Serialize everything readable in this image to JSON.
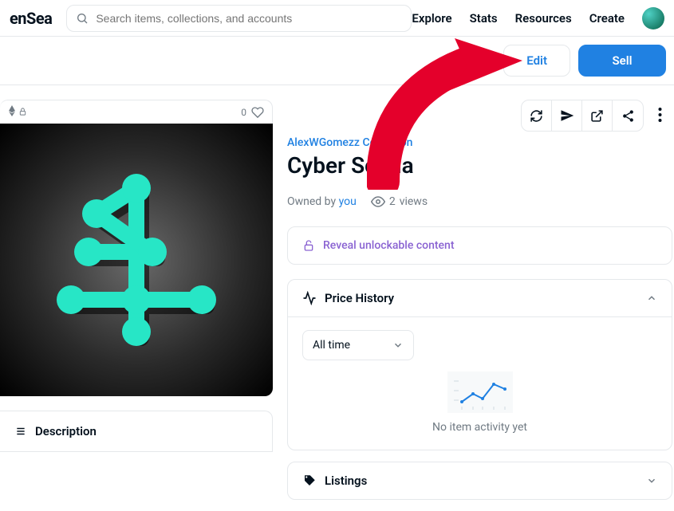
{
  "header": {
    "logo": "enSea",
    "search_placeholder": "Search items, collections, and accounts",
    "nav": {
      "explore": "Explore",
      "stats": "Stats",
      "resources": "Resources",
      "create": "Create"
    }
  },
  "actions": {
    "edit": "Edit",
    "sell": "Sell"
  },
  "item": {
    "fav_count": "0",
    "collection": "AlexWGomezz Collection",
    "title": "Cyber Scrilla",
    "owned_by_label": "Owned by",
    "owner": "you",
    "views_count": "2",
    "views_label": "views"
  },
  "unlock": {
    "label": "Reveal unlockable content"
  },
  "price_history": {
    "title": "Price History",
    "range": "All time",
    "empty": "No item activity yet"
  },
  "chart_data": {
    "type": "line",
    "categories": [],
    "values": [],
    "title": "Price History",
    "xlabel": "",
    "ylabel": "",
    "ylim": [
      0,
      0
    ]
  },
  "listings": {
    "title": "Listings"
  },
  "description": {
    "title": "Description"
  }
}
